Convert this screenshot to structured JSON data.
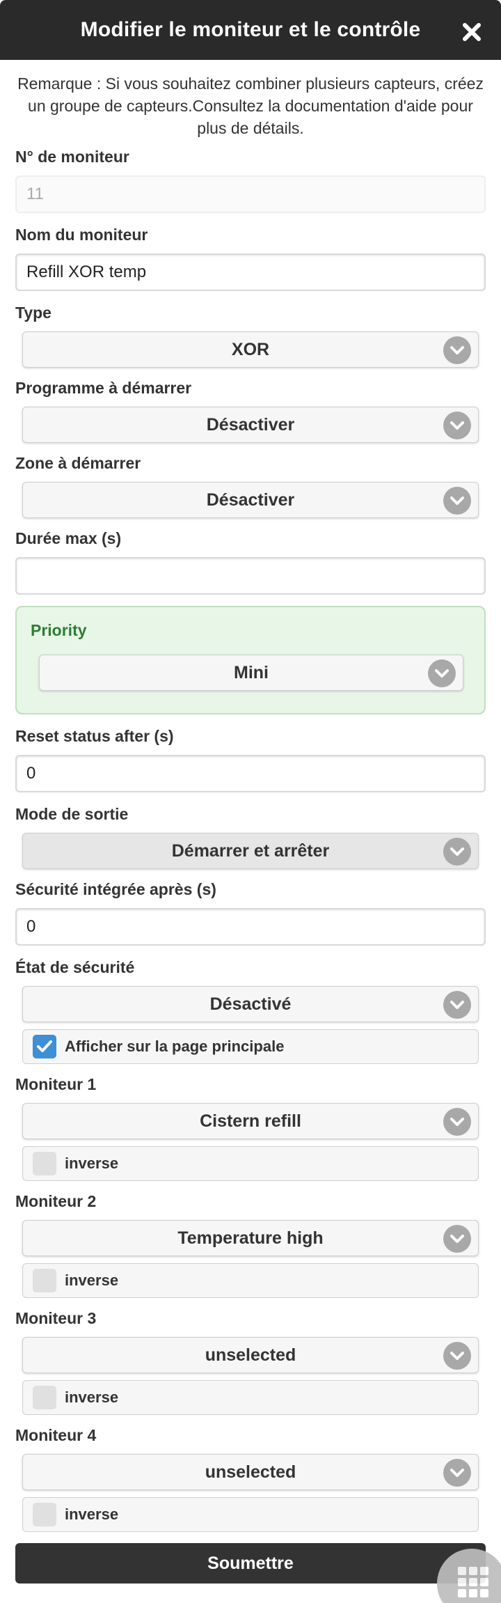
{
  "header": {
    "title": "Modifier le moniteur et le contrôle"
  },
  "note": "Remarque : Si vous souhaitez combiner plusieurs capteurs, créez un groupe de capteurs.Consultez la documentation d'aide pour plus de détails.",
  "fields": {
    "monitor_no": {
      "label": "N° de moniteur",
      "value": "11"
    },
    "monitor_name": {
      "label": "Nom du moniteur",
      "value": "Refill XOR temp"
    },
    "type": {
      "label": "Type",
      "value": "XOR"
    },
    "program": {
      "label": "Programme à démarrer",
      "value": "Désactiver"
    },
    "zone": {
      "label": "Zone à démarrer",
      "value": "Désactiver"
    },
    "max_duration": {
      "label": "Durée max (s)",
      "value": ""
    },
    "priority": {
      "label": "Priority",
      "value": "Mini"
    },
    "reset_status": {
      "label": "Reset status after (s)",
      "value": "0"
    },
    "output_mode": {
      "label": "Mode de sortie",
      "value": "Démarrer et arrêter"
    },
    "failsafe_after": {
      "label": "Sécurité intégrée après (s)",
      "value": "0"
    },
    "safety_state": {
      "label": "État de sécurité",
      "value": "Désactivé"
    },
    "show_main": {
      "label": "Afficher sur la page principale",
      "checked": true
    }
  },
  "monitors": [
    {
      "label": "Moniteur 1",
      "value": "Cistern refill",
      "inverse_label": "inverse",
      "inverse": false
    },
    {
      "label": "Moniteur 2",
      "value": "Temperature high",
      "inverse_label": "inverse",
      "inverse": false
    },
    {
      "label": "Moniteur 3",
      "value": "unselected",
      "inverse_label": "inverse",
      "inverse": false
    },
    {
      "label": "Moniteur 4",
      "value": "unselected",
      "inverse_label": "inverse",
      "inverse": false
    }
  ],
  "submit_label": "Soumettre",
  "icons": {
    "close": "close-icon",
    "chevron": "chevron-down-icon",
    "check": "check-icon",
    "grid": "grid-icon"
  },
  "colors": {
    "header_bg": "#2a2a2a",
    "priority_bg": "#e7f6e7",
    "priority_label": "#2e7d32",
    "checkbox_checked": "#3d8fd6"
  }
}
